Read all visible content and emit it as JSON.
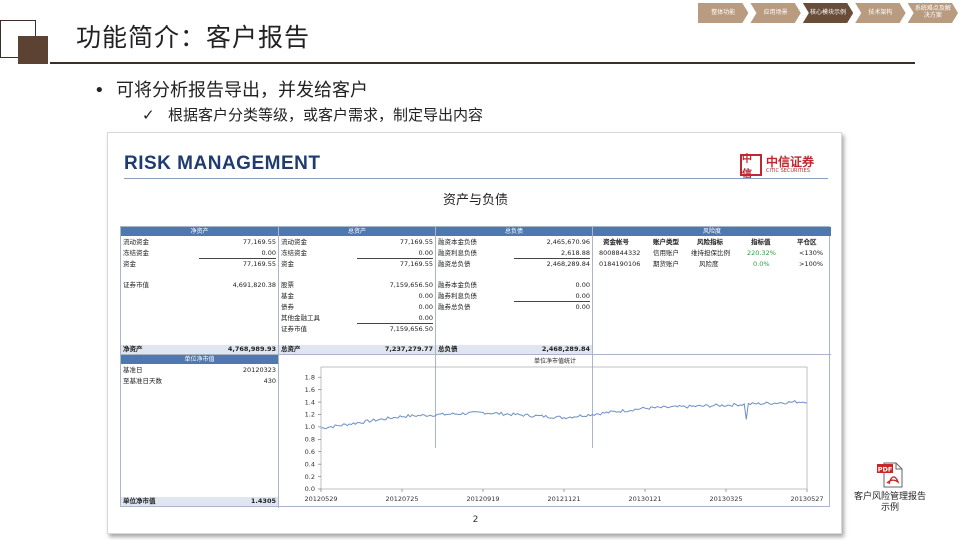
{
  "slide": {
    "title": "功能简介：客户报告",
    "bullet": "可将分析报告导出，并发给客户",
    "sub_bullet": "根据客户分类等级，或客户需求，制定导出内容",
    "bullet_symbol": "•",
    "check_symbol": "✓"
  },
  "breadcrumb": [
    {
      "label": "整体功能",
      "active": false
    },
    {
      "label": "应用场景",
      "active": false
    },
    {
      "label": "核心模块示例",
      "active": true
    },
    {
      "label": "技术架构",
      "active": false
    },
    {
      "label": "系统难点及解决方案",
      "active": false
    }
  ],
  "report": {
    "brand_title": "RISK MANAGEMENT",
    "logo_mark": "中信",
    "logo_cn": "中信证券",
    "logo_en": "CITIC SECURITIES",
    "heading": "资产与负债",
    "page_number": "2",
    "sections": {
      "net_assets": {
        "header": "净资产",
        "rows": [
          {
            "label": "流动资金",
            "value": "77,169.55"
          },
          {
            "label": "冻结资金",
            "value": "0.00"
          },
          {
            "label": "资金",
            "value": "77,169.55"
          },
          {
            "label": "证券市值",
            "value": "4,691,820.38"
          }
        ],
        "total_label": "净资产",
        "total_value": "4,768,989.93"
      },
      "total_assets": {
        "header": "总资产",
        "rows": [
          {
            "label": "流动资金",
            "value": "77,169.55"
          },
          {
            "label": "冻结资金",
            "value": "0.00"
          },
          {
            "label": "资金",
            "value": "77,169.55"
          },
          {
            "label": "股票",
            "value": "7,159,656.50"
          },
          {
            "label": "基金",
            "value": "0.00"
          },
          {
            "label": "债券",
            "value": "0.00"
          },
          {
            "label": "其他金融工具",
            "value": "0.00"
          },
          {
            "label": "证券市值",
            "value": "7,159,656.50"
          }
        ],
        "total_label": "总资产",
        "total_value": "7,237,279.77"
      },
      "liabilities": {
        "header": "总负债",
        "rows": [
          {
            "label": "融资本金负债",
            "value": "2,465,670.96"
          },
          {
            "label": "融资利息负债",
            "value": "2,618.88"
          },
          {
            "label": "融资总负债",
            "value": "2,468,289.84"
          },
          {
            "label": "融券本金负债",
            "value": "0.00"
          },
          {
            "label": "融券利息负债",
            "value": "0.00"
          },
          {
            "label": "融券总负债",
            "value": "0.00"
          }
        ],
        "total_label": "总负债",
        "total_value": "2,468,289.84"
      },
      "risk": {
        "header": "风险度",
        "columns": [
          "资金帐号",
          "账户类型",
          "风险指标",
          "指标值",
          "平仓区"
        ],
        "rows": [
          [
            "8008844332",
            "信用账户",
            "维持担保比例",
            "220.32%",
            "<130%"
          ],
          [
            "0184190106",
            "期货账户",
            "风险度",
            "0.0%",
            ">100%"
          ]
        ]
      },
      "unit_nav": {
        "header": "单位净市值",
        "rows": [
          {
            "label": "基准日",
            "value": "20120323"
          },
          {
            "label": "至基准日天数",
            "value": "430"
          }
        ],
        "total_label": "单位净市值",
        "total_value": "1.4305"
      }
    }
  },
  "chart_data": {
    "type": "line",
    "title": "单位净市值统计",
    "xlabel": "",
    "ylabel": "",
    "x_ticks": [
      "20120529",
      "20120725",
      "20120919",
      "20121121",
      "20130121",
      "20130325",
      "20130527"
    ],
    "y_ticks": [
      "0.0",
      "0.2",
      "0.4",
      "0.6",
      "0.8",
      "1.0",
      "1.2",
      "1.4",
      "1.6",
      "1.8"
    ],
    "ylim": [
      0,
      1.9
    ],
    "grid": false,
    "series_color": "#6d8fc7",
    "x": [
      "20120529",
      "20120725",
      "20120919",
      "20121121",
      "20130121",
      "20130325",
      "20130527"
    ],
    "y": [
      0.98,
      1.17,
      1.23,
      1.15,
      1.3,
      1.35,
      1.41
    ]
  },
  "attachment": {
    "icon_label": "PDF",
    "caption_line1": "客户风险管理报告",
    "caption_line2": "示例"
  }
}
